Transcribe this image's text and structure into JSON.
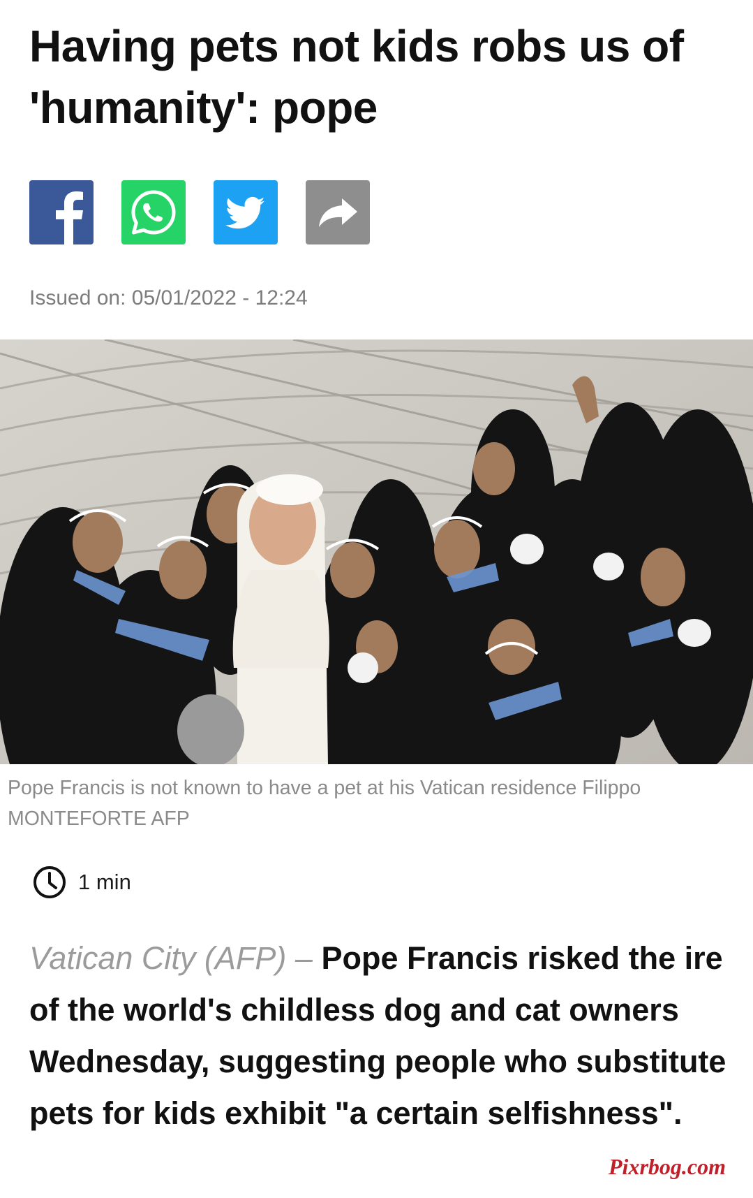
{
  "article": {
    "headline": "Having pets not kids robs us of 'humanity': pope",
    "issued": "Issued on: 05/01/2022 - 12:24",
    "image": {
      "caption": "Pope Francis is not known to have a pet at his Vatican residence Filippo MONTEFORTE AFP"
    },
    "read_time": "1 min",
    "dateline": "Vatican City (AFP) –",
    "lead": "Pope Francis risked the ire of the world's childless dog and cat owners Wednesday, suggesting people who substitute pets for kids exhibit \"a certain selfishness\"."
  },
  "share": {
    "buttons": [
      {
        "network": "facebook",
        "icon": "facebook-icon",
        "color": "#3b5998"
      },
      {
        "network": "whatsapp",
        "icon": "whatsapp-icon",
        "color": "#25d366"
      },
      {
        "network": "twitter",
        "icon": "twitter-icon",
        "color": "#1da1f2"
      },
      {
        "network": "share",
        "icon": "share-arrow-icon",
        "color": "#8e8e8e"
      }
    ]
  },
  "watermark": "Pixrbog.com",
  "colors": {
    "text": "#111111",
    "meta": "#7c7c7c",
    "caption": "#8a8a8a",
    "dateline": "#9b9b9b",
    "watermark": "#c0202a"
  }
}
